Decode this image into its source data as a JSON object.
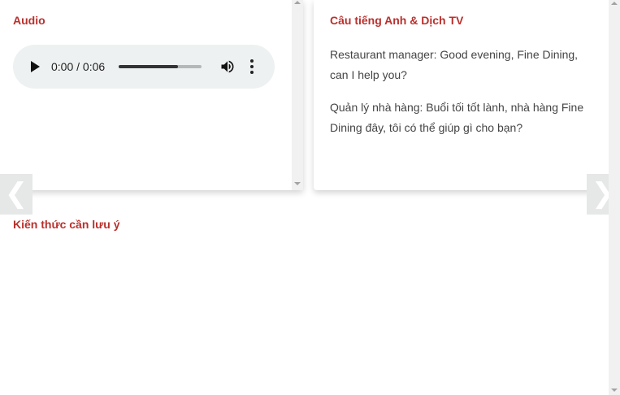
{
  "audio_card": {
    "title": "Audio",
    "player": {
      "current_time": "0:00",
      "separator": " / ",
      "duration": "0:06",
      "progress_fraction": 0.72
    }
  },
  "text_card": {
    "title": "Câu tiếng Anh & Dịch TV",
    "english": "Restaurant manager: Good evening, Fine Dining, can I help you?",
    "vietnamese": "Quản lý nhà hàng: Buổi tối tốt lành, nhà hàng Fine Dining đây, tôi có thể giúp gì cho bạn?"
  },
  "notes_section": {
    "title": "Kiến thức cần lưu ý"
  },
  "navigation": {
    "prev_glyph": "❮",
    "next_glyph": "❯"
  },
  "icons": {
    "play": "play-icon",
    "volume": "volume-icon",
    "menu": "more-vertical-icon"
  },
  "colors": {
    "accent": "#b9302d",
    "player_bg": "#eef1f1",
    "nav_bg": "#e6e7e7"
  }
}
